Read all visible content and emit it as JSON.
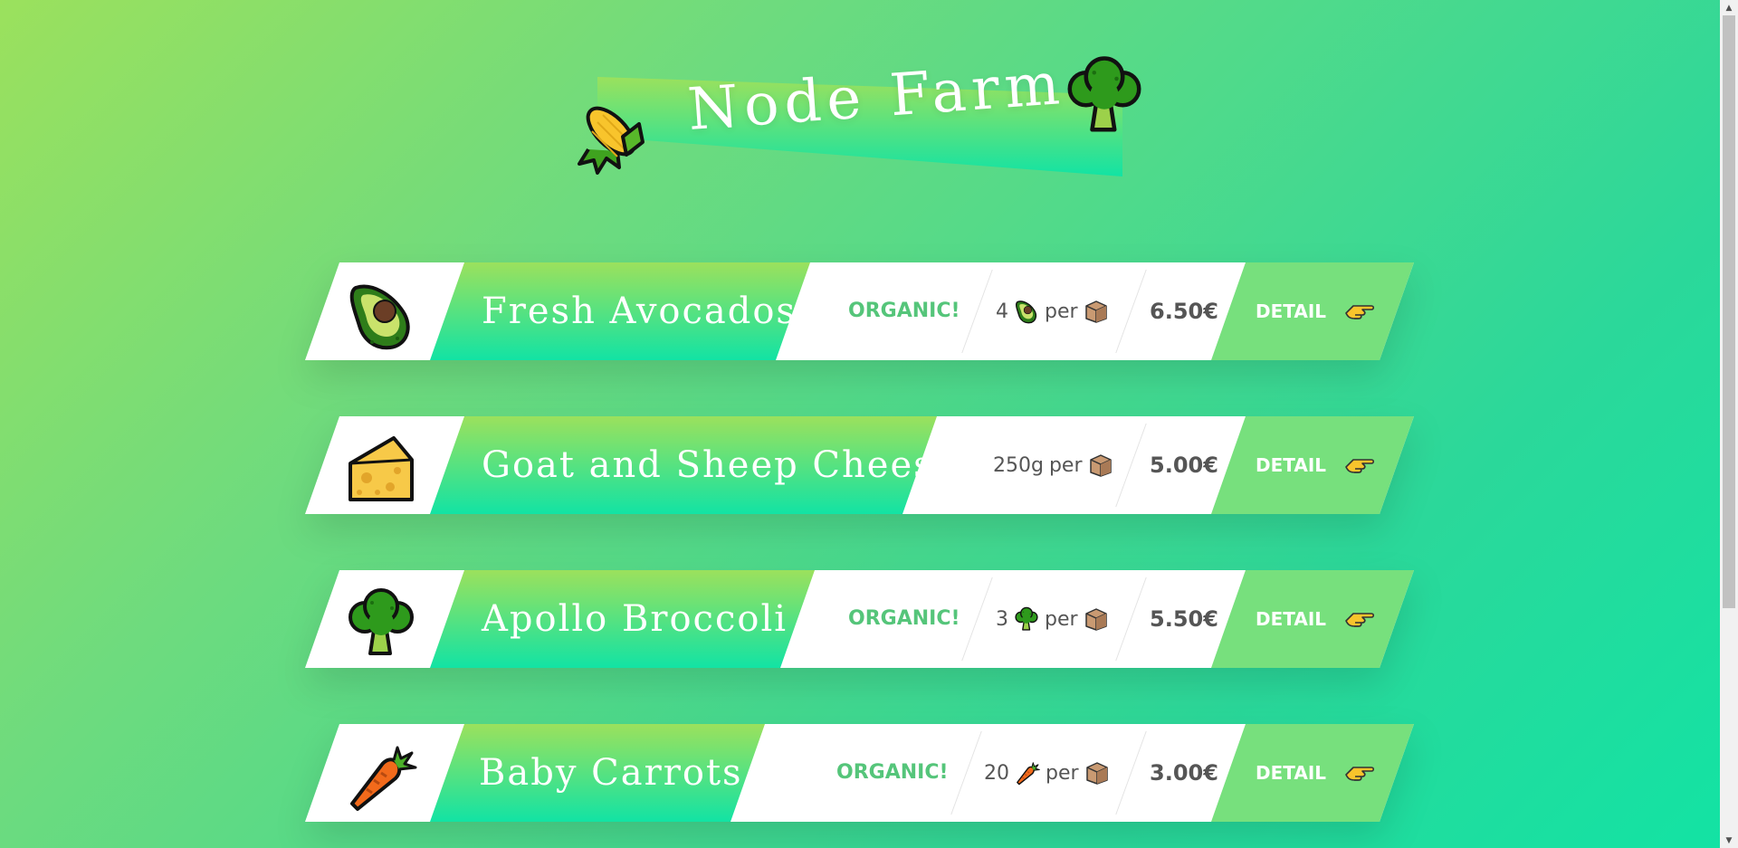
{
  "app": {
    "title": "Node Farm"
  },
  "header": {
    "title": "Node Farm",
    "left_icon": "corn-icon",
    "right_icon": "broccoli-icon"
  },
  "colors": {
    "gradient_start": "#9be15d",
    "gradient_end": "#12e3a4",
    "organic": "#55c57a",
    "detail_bg": "#77e07d",
    "text": "#555555"
  },
  "products": [
    {
      "name": "Fresh Avocados",
      "icon": "avocado-icon",
      "organic_label": "ORGANIC!",
      "quantity": "4",
      "unit_icon": "avocado-icon",
      "per": "per",
      "box_icon": "box-icon",
      "price": "6.50€",
      "detail_label": "DETAIL",
      "detail_icon": "pointing-hand-icon"
    },
    {
      "name": "Goat and Sheep Cheese",
      "icon": "cheese-icon",
      "organic_label": "",
      "quantity": "250g",
      "unit_icon": "",
      "per": "per",
      "box_icon": "box-icon",
      "price": "5.00€",
      "detail_label": "DETAIL",
      "detail_icon": "pointing-hand-icon"
    },
    {
      "name": "Apollo Broccoli",
      "icon": "broccoli-icon",
      "organic_label": "ORGANIC!",
      "quantity": "3",
      "unit_icon": "broccoli-icon",
      "per": "per",
      "box_icon": "box-icon",
      "price": "5.50€",
      "detail_label": "DETAIL",
      "detail_icon": "pointing-hand-icon"
    },
    {
      "name": "Baby Carrots",
      "icon": "carrot-icon",
      "organic_label": "ORGANIC!",
      "quantity": "20",
      "unit_icon": "carrot-icon",
      "per": "per",
      "box_icon": "box-icon",
      "price": "3.00€",
      "detail_label": "DETAIL",
      "detail_icon": "pointing-hand-icon"
    }
  ]
}
